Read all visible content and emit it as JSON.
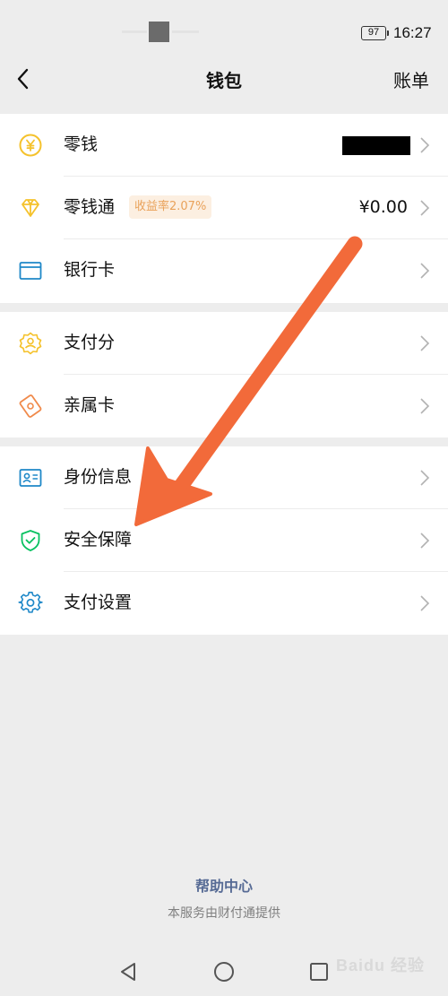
{
  "status_bar": {
    "battery": "97",
    "time": "16:27"
  },
  "nav": {
    "title": "钱包",
    "right_link": "账单"
  },
  "wallet": {
    "change": {
      "label": "零钱"
    },
    "change_plus": {
      "label": "零钱通",
      "badge": "收益率2.07%",
      "amount": "¥0.00"
    },
    "bank_card": {
      "label": "银行卡"
    }
  },
  "services": {
    "pay_score": {
      "label": "支付分"
    },
    "family_card": {
      "label": "亲属卡"
    }
  },
  "settings": {
    "identity": {
      "label": "身份信息"
    },
    "security": {
      "label": "安全保障"
    },
    "pay_settings": {
      "label": "支付设置"
    }
  },
  "footer": {
    "help_link": "帮助中心",
    "note": "本服务由财付通提供"
  },
  "watermark": "Baidu 经验",
  "colors": {
    "accent_yellow": "#f5c22c",
    "accent_blue": "#1e88c8",
    "accent_green": "#07c160",
    "arrow": "#f26a3a",
    "link": "#576b95"
  }
}
